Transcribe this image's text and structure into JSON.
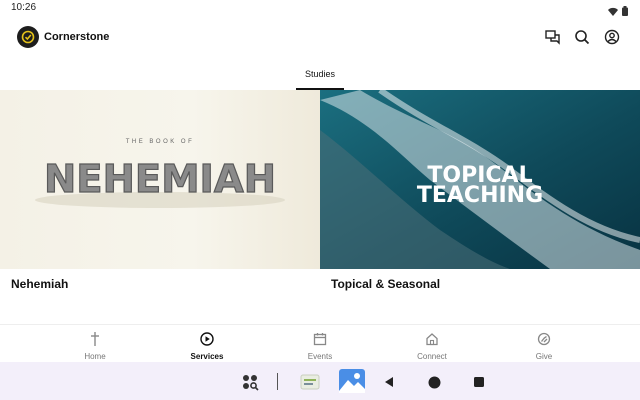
{
  "status_bar": {
    "time": "10:26",
    "icons": [
      "wifi-icon",
      "battery-icon"
    ]
  },
  "header": {
    "title": "Cornerstone",
    "icons": [
      "chat-icon",
      "search-icon",
      "account-icon"
    ]
  },
  "tabs": [
    {
      "label": "Studies",
      "active": true
    }
  ],
  "cards": [
    {
      "title": "Nehemiah",
      "thumb": {
        "kicker": "THE BOOK OF",
        "headline": "NEHEMIAH"
      }
    },
    {
      "title": "Topical & Seasonal",
      "thumb": {
        "line1": "TOPICAL",
        "line2": "TEACHING"
      }
    }
  ],
  "bottom_nav": [
    {
      "label": "Home",
      "icon": "cross-icon",
      "active": false
    },
    {
      "label": "Services",
      "icon": "play-circle-icon",
      "active": true
    },
    {
      "label": "Events",
      "icon": "calendar-icon",
      "active": false
    },
    {
      "label": "Connect",
      "icon": "home-outline-icon",
      "active": false
    },
    {
      "label": "Give",
      "icon": "give-icon",
      "active": false
    }
  ],
  "system_bar": {
    "buttons": [
      "app-drawer-icon",
      "recent-app-1-icon",
      "gallery-icon",
      "back-icon",
      "home-icon",
      "recents-icon"
    ]
  },
  "colors": {
    "accent": "#111111",
    "inactive": "#777777",
    "system_bar": "#f3effa",
    "ocean": "#0f4a5a"
  }
}
